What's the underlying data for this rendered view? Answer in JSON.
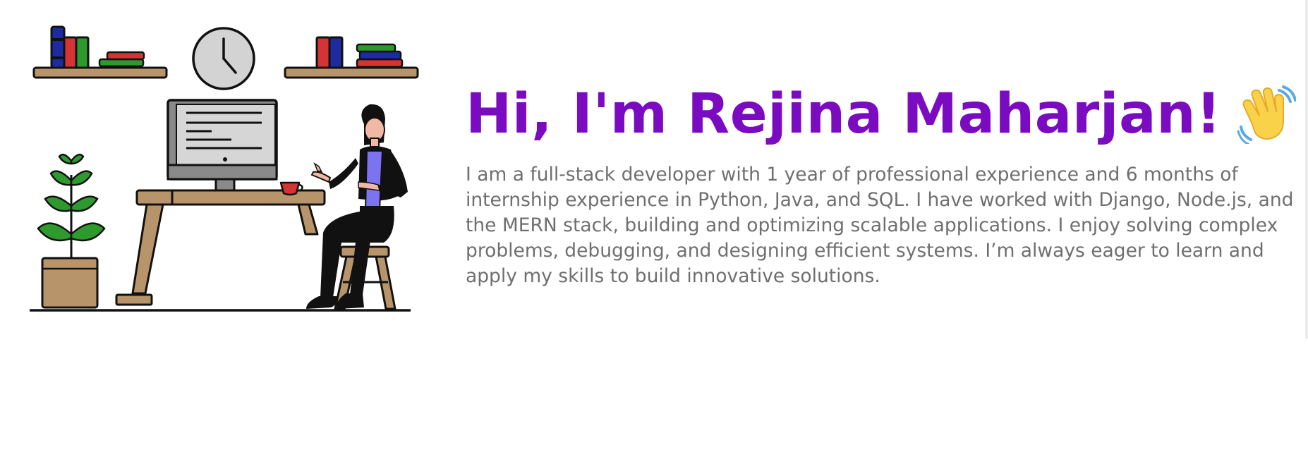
{
  "hero": {
    "greeting": "Hi, I'm Rejina Maharjan!",
    "wave_icon": "waving-hand-icon",
    "bio": "I am a full-stack developer with 1 year of professional experience and 6 months of internship experience in Python, Java, and SQL. I have worked with Django, Node.js, and the MERN stack, building and optimizing scalable applications. I enjoy solving complex problems, debugging, and designing efficient systems. I’m always eager to learn and apply my skills to build innovative solutions."
  },
  "illustration": {
    "name": "developer-at-desk-illustration",
    "icons": [
      "clock-icon",
      "bookshelf-icon",
      "monitor-icon",
      "plant-icon",
      "coffee-cup-icon",
      "person-icon"
    ]
  },
  "colors": {
    "headline": "#7a0bc0",
    "body_text": "#6f6f6f",
    "wood": "#b8946a",
    "shirt": "#7b73f0"
  }
}
